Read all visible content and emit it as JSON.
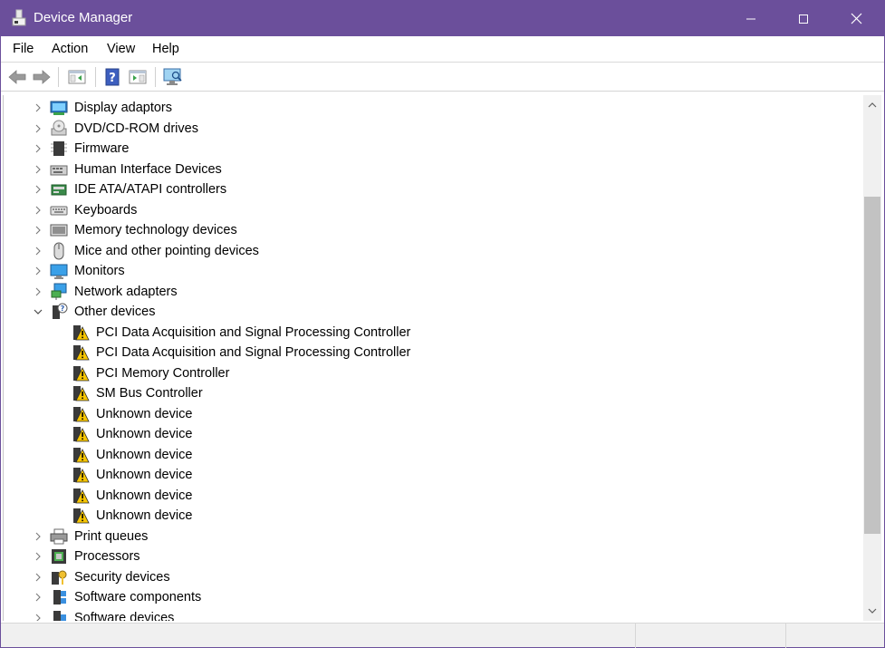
{
  "window": {
    "title": "Device Manager",
    "title_bar_color": "#6b4f9b",
    "controls": [
      "minimize",
      "maximize",
      "close"
    ]
  },
  "menu": {
    "items": [
      {
        "label": "File"
      },
      {
        "label": "Action"
      },
      {
        "label": "View"
      },
      {
        "label": "Help"
      }
    ]
  },
  "toolbar": {
    "buttons": [
      {
        "icon": "back-arrow-icon"
      },
      {
        "icon": "forward-arrow-icon"
      },
      {
        "icon": "show-hide-console-tree-icon"
      },
      {
        "icon": "help-icon"
      },
      {
        "icon": "properties-pane-icon"
      },
      {
        "icon": "scan-hardware-icon"
      }
    ]
  },
  "tree": {
    "rows": [
      {
        "label": "Display adaptors",
        "icon": "display-adapter-icon",
        "expanded": false,
        "level": 0
      },
      {
        "label": "DVD/CD-ROM drives",
        "icon": "dvd-drive-icon",
        "expanded": false,
        "level": 0
      },
      {
        "label": "Firmware",
        "icon": "firmware-icon",
        "expanded": false,
        "level": 0
      },
      {
        "label": "Human Interface Devices",
        "icon": "hid-icon",
        "expanded": false,
        "level": 0
      },
      {
        "label": "IDE ATA/ATAPI controllers",
        "icon": "ide-controller-icon",
        "expanded": false,
        "level": 0
      },
      {
        "label": "Keyboards",
        "icon": "keyboard-icon",
        "expanded": false,
        "level": 0
      },
      {
        "label": "Memory technology devices",
        "icon": "memory-device-icon",
        "expanded": false,
        "level": 0
      },
      {
        "label": "Mice and other pointing devices",
        "icon": "mouse-icon",
        "expanded": false,
        "level": 0
      },
      {
        "label": "Monitors",
        "icon": "monitor-icon",
        "expanded": false,
        "level": 0
      },
      {
        "label": "Network adapters",
        "icon": "network-adapter-icon",
        "expanded": false,
        "level": 0
      },
      {
        "label": "Other devices",
        "icon": "other-devices-icon",
        "expanded": true,
        "level": 0
      },
      {
        "label": "PCI Data Acquisition and Signal Processing Controller",
        "icon": "warning-device-icon",
        "level": 1
      },
      {
        "label": "PCI Data Acquisition and Signal Processing Controller",
        "icon": "warning-device-icon",
        "level": 1
      },
      {
        "label": "PCI Memory Controller",
        "icon": "warning-device-icon",
        "level": 1
      },
      {
        "label": "SM Bus Controller",
        "icon": "warning-device-icon",
        "level": 1
      },
      {
        "label": "Unknown device",
        "icon": "warning-device-icon",
        "level": 1
      },
      {
        "label": "Unknown device",
        "icon": "warning-device-icon",
        "level": 1
      },
      {
        "label": "Unknown device",
        "icon": "warning-device-icon",
        "level": 1
      },
      {
        "label": "Unknown device",
        "icon": "warning-device-icon",
        "level": 1
      },
      {
        "label": "Unknown device",
        "icon": "warning-device-icon",
        "level": 1
      },
      {
        "label": "Unknown device",
        "icon": "warning-device-icon",
        "level": 1
      },
      {
        "label": "Print queues",
        "icon": "printer-icon",
        "expanded": false,
        "level": 0
      },
      {
        "label": "Processors",
        "icon": "processor-icon",
        "expanded": false,
        "level": 0
      },
      {
        "label": "Security devices",
        "icon": "security-device-icon",
        "expanded": false,
        "level": 0
      },
      {
        "label": "Software components",
        "icon": "software-component-icon",
        "expanded": false,
        "level": 0
      },
      {
        "label": "Software devices",
        "icon": "software-device-icon",
        "expanded": false,
        "level": 0
      }
    ]
  }
}
